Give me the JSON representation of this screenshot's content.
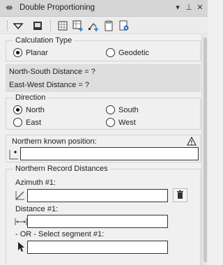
{
  "titlebar": {
    "title": "Double Proportioning",
    "pin_icon": "pin-icon",
    "controls": [
      "▾",
      "⊥",
      "✕"
    ]
  },
  "toolbar": {
    "buttons": [
      "menu-dropdown-icon",
      "screen-icon",
      "grid-select-icon",
      "grid-add-icon",
      "add-point-icon",
      "clipboard-icon",
      "document-settings-icon"
    ]
  },
  "calc_type": {
    "legend": "Calculation Type",
    "options": [
      {
        "label": "Planar",
        "checked": true
      },
      {
        "label": "Geodetic",
        "checked": false
      }
    ]
  },
  "info": {
    "ns_distance": "North-South Distance = ?",
    "ew_distance": "East-West Distance = ?"
  },
  "direction": {
    "legend": "Direction",
    "options": [
      {
        "label": "North",
        "checked": true
      },
      {
        "label": "South",
        "checked": false
      },
      {
        "label": "East",
        "checked": false
      },
      {
        "label": "West",
        "checked": false
      }
    ]
  },
  "known_position": {
    "label": "Northern known position:",
    "value": ""
  },
  "record_distances": {
    "legend": "Northern Record Distances",
    "azimuth_label": "Azimuth #1:",
    "azimuth_value": "",
    "distance_label": "Distance #1:",
    "distance_value": "",
    "select_label": "- OR - Select segment #1:",
    "segment_value": ""
  }
}
